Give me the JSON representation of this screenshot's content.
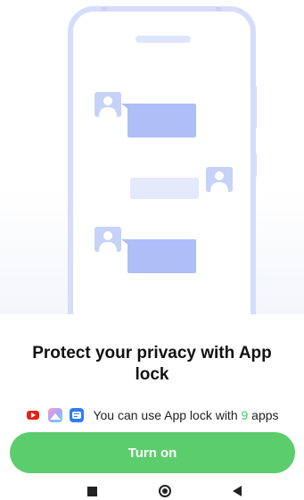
{
  "title": "Protect your privacy with App lock",
  "apps": {
    "icons": [
      "youtube-icon",
      "gallery-icon",
      "messages-icon"
    ],
    "text_prefix": "You can use App lock with ",
    "count": "9",
    "text_suffix": " apps"
  },
  "turn_on_label": "Turn on",
  "colors": {
    "accent": "#5ccd6c",
    "count_green": "#3ccc63",
    "illustration_blue": "#b2c1f6"
  },
  "nav": [
    "recent-apps-icon",
    "home-icon",
    "back-icon"
  ]
}
